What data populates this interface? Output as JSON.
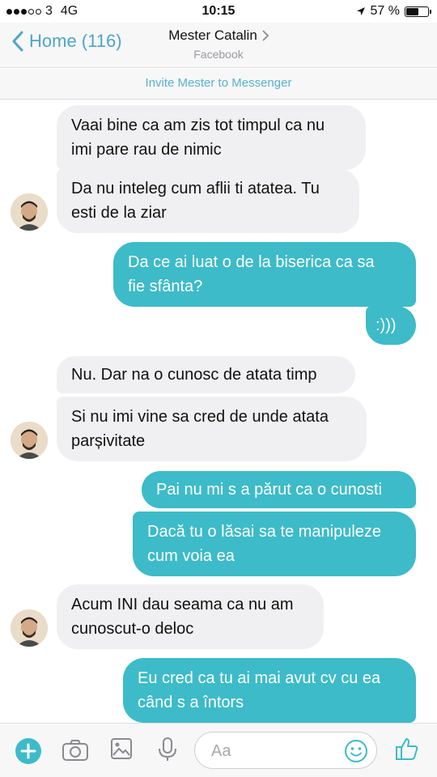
{
  "status_bar": {
    "carrier": "3",
    "network": "4G",
    "time": "10:15",
    "battery_pct": "57 %",
    "battery_level": 0.57
  },
  "nav": {
    "back_label": "Home (116)",
    "contact_name": "Mester Catalin",
    "subtitle": "Facebook"
  },
  "invite_label": "Invite Mester to Messenger",
  "messages": [
    {
      "dir": "in",
      "line1": "Vaai bine ca am zis tot timpul ca nu",
      "line2": "imi pare rau de nimic"
    },
    {
      "dir": "in",
      "line1": "Da nu inteleg cum aflii ti atatea. Tu",
      "line2": "esti de la ziar"
    },
    {
      "dir": "out",
      "line1": "Da ce ai luat o de la biserica ca sa",
      "line2": "fie sfânta?"
    },
    {
      "dir": "out",
      "line1": ":)))"
    },
    {
      "dir": "in",
      "line1": "Nu. Dar na o cunosc de atata timp"
    },
    {
      "dir": "in",
      "line1": "Si nu imi vine sa cred de unde atata",
      "line2": "parșivitate"
    },
    {
      "dir": "out",
      "line1": "Pai nu mi s a părut ca o cunosti"
    },
    {
      "dir": "out",
      "line1": "Dacă tu o lăsai sa te manipuleze",
      "line2": "cum voia ea"
    },
    {
      "dir": "in",
      "line1": "Acum INI dau seama ca nu am",
      "line2": "cunoscut-o deloc"
    },
    {
      "dir": "out",
      "line1": "Eu cred ca tu ai mai avut cv cu ea",
      "line2": "când s a întors"
    }
  ],
  "composer": {
    "placeholder": "Aa"
  },
  "colors": {
    "accent": "#4fa6c4",
    "outgoing_bubble": "#3dbbc8",
    "incoming_bubble": "#f0f0f2"
  },
  "icons": [
    "plus-icon",
    "camera-icon",
    "image-icon",
    "microphone-icon",
    "emoji-icon",
    "thumbs-up-icon"
  ]
}
